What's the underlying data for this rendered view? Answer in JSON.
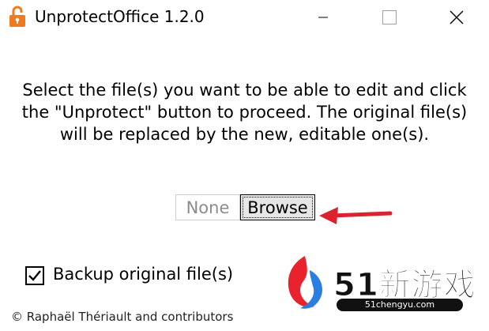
{
  "window": {
    "title": "UnprotectOffice 1.2.0",
    "controls": {
      "minimize": "minimize-icon",
      "maximize": "maximize-icon",
      "close": "close-icon"
    }
  },
  "main": {
    "instructions": [
      "Select the file(s) you want to be able to edit and click",
      "the \"Unprotect\" button to proceed. The original file(s)",
      "will be replaced by the new, editable one(s)."
    ],
    "buttons": {
      "none_label": "None",
      "browse_label": "Browse"
    },
    "backup": {
      "label": "Backup original file(s)",
      "checked": true
    }
  },
  "footer": {
    "credits": "© Raphaël Thériault and contributors"
  },
  "watermark": {
    "main": "51新游戏",
    "sub": "51chengyu.com"
  },
  "colors": {
    "icon_orange": "#f07a1f",
    "arrow_red": "#d9232e",
    "watermark_red": "#e8232e",
    "watermark_blue": "#2a7de1"
  }
}
